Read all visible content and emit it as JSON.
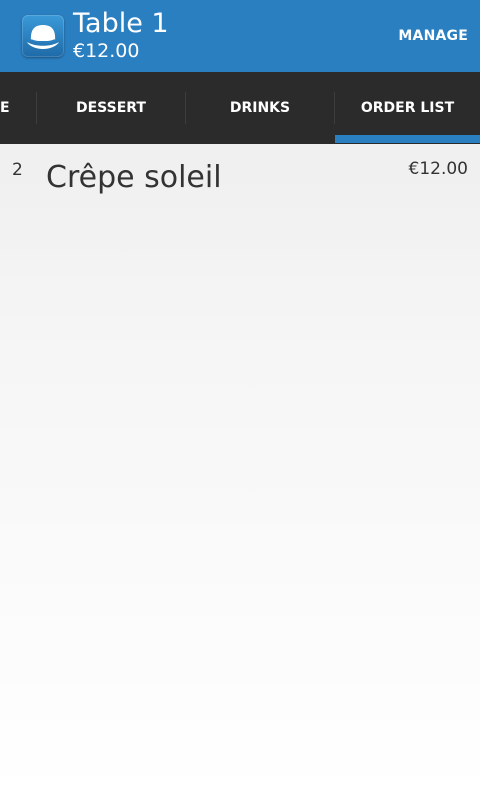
{
  "header": {
    "table_name": "Table 1",
    "total": "€12.00",
    "manage_label": "MANAGE",
    "app_icon": "hat-icon"
  },
  "tabs": [
    {
      "label": "E"
    },
    {
      "label": "DESSERT"
    },
    {
      "label": "DRINKS"
    },
    {
      "label": "ORDER LIST",
      "selected": true
    }
  ],
  "order": {
    "items": [
      {
        "qty": "2",
        "name": "Crêpe soleil",
        "price": "€12.00"
      }
    ]
  },
  "colors": {
    "accent": "#2a7fc1",
    "tab_bar": "#2b2b2b"
  }
}
